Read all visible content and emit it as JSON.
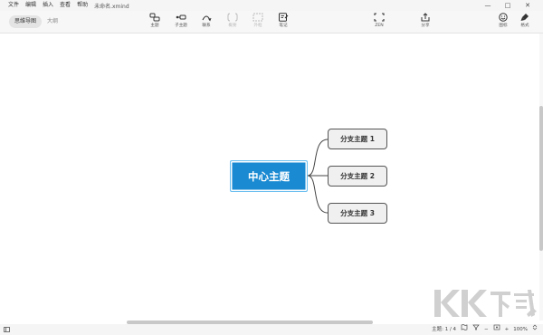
{
  "menubar": {
    "items": [
      "文件",
      "编辑",
      "插入",
      "查看",
      "帮助"
    ],
    "doc_title": "未命名.xmind",
    "controls": [
      "—",
      "□",
      "✕"
    ]
  },
  "toolbar": {
    "view_tabs": [
      "思维导图",
      "大纲"
    ],
    "tools": [
      {
        "label": "主题",
        "icon": "topic-icon"
      },
      {
        "label": "子主题",
        "icon": "subtopic-icon"
      },
      {
        "label": "联系",
        "icon": "relationship-icon"
      },
      {
        "label": "概要",
        "icon": "summary-icon"
      },
      {
        "label": "外框",
        "icon": "boundary-icon"
      },
      {
        "label": "笔记",
        "icon": "note-icon"
      }
    ],
    "zen_label": "ZEN",
    "share_label": "分享",
    "icons_label": "图标",
    "format_label": "格式"
  },
  "mindmap": {
    "central_topic": "中心主题",
    "subtopics": [
      "分支主题 1",
      "分支主题 2",
      "分支主题 3"
    ],
    "central_color": "#1a8ad2"
  },
  "statusbar": {
    "topic_count": "主题: 1 / 4",
    "zoom": "100%",
    "zoom_minus": "−",
    "zoom_plus": "+"
  },
  "watermark": {
    "text": "KK下载"
  }
}
